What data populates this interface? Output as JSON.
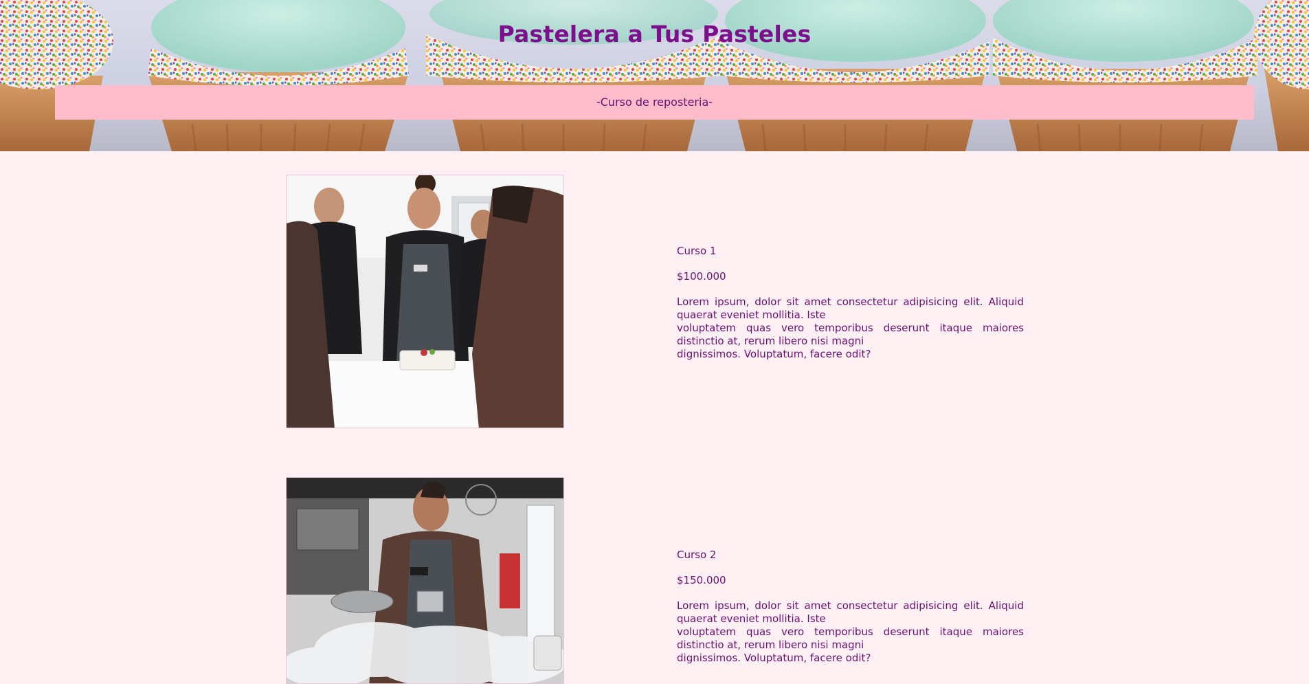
{
  "header": {
    "title": "Pastelera a Tus Pasteles",
    "subtitle": "-Curso de reposteria-"
  },
  "courses": [
    {
      "name": "Curso 1",
      "price": "$100.000",
      "description": [
        "Lorem ipsum, dolor sit amet consectetur adipisicing elit. Aliquid quaerat eveniet mollitia. Iste",
        "voluptatem quas vero temporibus deserunt itaque maiores distinctio at, rerum libero nisi magni",
        "dignissimos. Voluptatum, facere odit?"
      ]
    },
    {
      "name": "Curso 2",
      "price": "$150.000",
      "description": [
        "Lorem ipsum, dolor sit amet consectetur adipisicing elit. Aliquid quaerat eveniet mollitia. Iste",
        "voluptatem quas vero temporibus deserunt itaque maiores distinctio at, rerum libero nisi magni",
        "dignissimos. Voluptatum, facere odit?"
      ]
    }
  ],
  "colors": {
    "page_background": "#fff0f3",
    "title_text": "#7d0f8c",
    "body_text": "#6b0f73",
    "subtitle_band": "#ffbccb"
  }
}
